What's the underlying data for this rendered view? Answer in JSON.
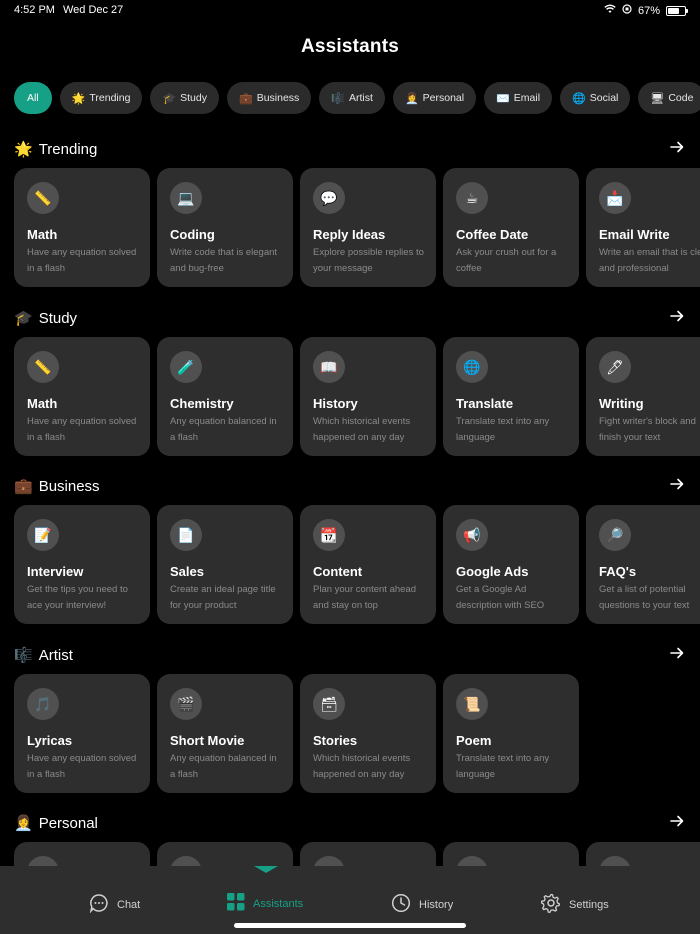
{
  "status": {
    "time": "4:52 PM",
    "date": "Wed Dec 27",
    "battery": "67%",
    "battery_level": 0.67
  },
  "title": "Assistants",
  "chips": [
    {
      "emoji": "",
      "label": "All"
    },
    {
      "emoji": "🌟",
      "label": "Trending"
    },
    {
      "emoji": "🎓",
      "label": "Study"
    },
    {
      "emoji": "💼",
      "label": "Business"
    },
    {
      "emoji": "🎼",
      "label": "Artist"
    },
    {
      "emoji": "👩‍💼",
      "label": "Personal"
    },
    {
      "emoji": "✉️",
      "label": "Email"
    },
    {
      "emoji": "🌐",
      "label": "Social"
    },
    {
      "emoji": "🖥",
      "label": "Code"
    }
  ],
  "sections": [
    {
      "emoji": "🌟",
      "title": "Trending",
      "cards": [
        {
          "icon": "📏",
          "title": "Math",
          "desc": "Have any equation solved in a flash"
        },
        {
          "icon": "💻",
          "title": "Coding",
          "desc": "Write code that is elegant and bug-free"
        },
        {
          "icon": "💬",
          "title": "Reply Ideas",
          "desc": "Explore possible replies to your message"
        },
        {
          "icon": "☕",
          "title": "Coffee Date",
          "desc": "Ask your crush out for a coffee"
        },
        {
          "icon": "📩",
          "title": "Email Write",
          "desc": "Write an email that is clear and professional"
        }
      ]
    },
    {
      "emoji": "🎓",
      "title": "Study",
      "cards": [
        {
          "icon": "📏",
          "title": "Math",
          "desc": "Have any equation solved in a flash"
        },
        {
          "icon": "🧪",
          "title": "Chemistry",
          "desc": "Any equation balanced in a flash"
        },
        {
          "icon": "📖",
          "title": "History",
          "desc": "Which historical events happened on any day"
        },
        {
          "icon": "🌐",
          "title": "Translate",
          "desc": "Translate text into any language"
        },
        {
          "icon": "🖊",
          "title": "Writing",
          "desc": "Fight writer's block and finish your text"
        }
      ]
    },
    {
      "emoji": "💼",
      "title": "Business",
      "cards": [
        {
          "icon": "📝",
          "title": "Interview",
          "desc": "Get the tips you need to ace your interview!"
        },
        {
          "icon": "📄",
          "title": "Sales",
          "desc": "Create an ideal page title for your product"
        },
        {
          "icon": "📆",
          "title": "Content",
          "desc": "Plan your content ahead and stay on top"
        },
        {
          "icon": "📢",
          "title": "Google Ads",
          "desc": "Get a Google Ad description with SEO"
        },
        {
          "icon": "🔎",
          "title": "FAQ's",
          "desc": "Get a list of potential questions to your text"
        }
      ]
    },
    {
      "emoji": "🎼",
      "title": "Artist",
      "cards": [
        {
          "icon": "🎵",
          "title": "Lyricas",
          "desc": "Have any equation solved in a flash"
        },
        {
          "icon": "🎬",
          "title": "Short Movie",
          "desc": "Any equation balanced in a flash"
        },
        {
          "icon": "🗃",
          "title": "Stories",
          "desc": "Which historical events happened on any day"
        },
        {
          "icon": "📜",
          "title": "Poem",
          "desc": "Translate text into any language"
        }
      ]
    },
    {
      "emoji": "👩‍💼",
      "title": "Personal",
      "cards": [
        {
          "icon": "",
          "title": "",
          "desc": ""
        },
        {
          "icon": "",
          "title": "",
          "desc": ""
        },
        {
          "icon": "",
          "title": "",
          "desc": ""
        },
        {
          "icon": "",
          "title": "",
          "desc": ""
        },
        {
          "icon": "",
          "title": "",
          "desc": ""
        }
      ]
    }
  ],
  "tabs": [
    {
      "icon": "chat-bubble-icon",
      "label": "Chat"
    },
    {
      "icon": "grid-icon",
      "label": "Assistants"
    },
    {
      "icon": "clock-icon",
      "label": "History"
    },
    {
      "icon": "gear-icon",
      "label": "Settings"
    }
  ],
  "colors": {
    "accent": "#16a085",
    "card": "#2e2e2e",
    "background": "#000000"
  }
}
